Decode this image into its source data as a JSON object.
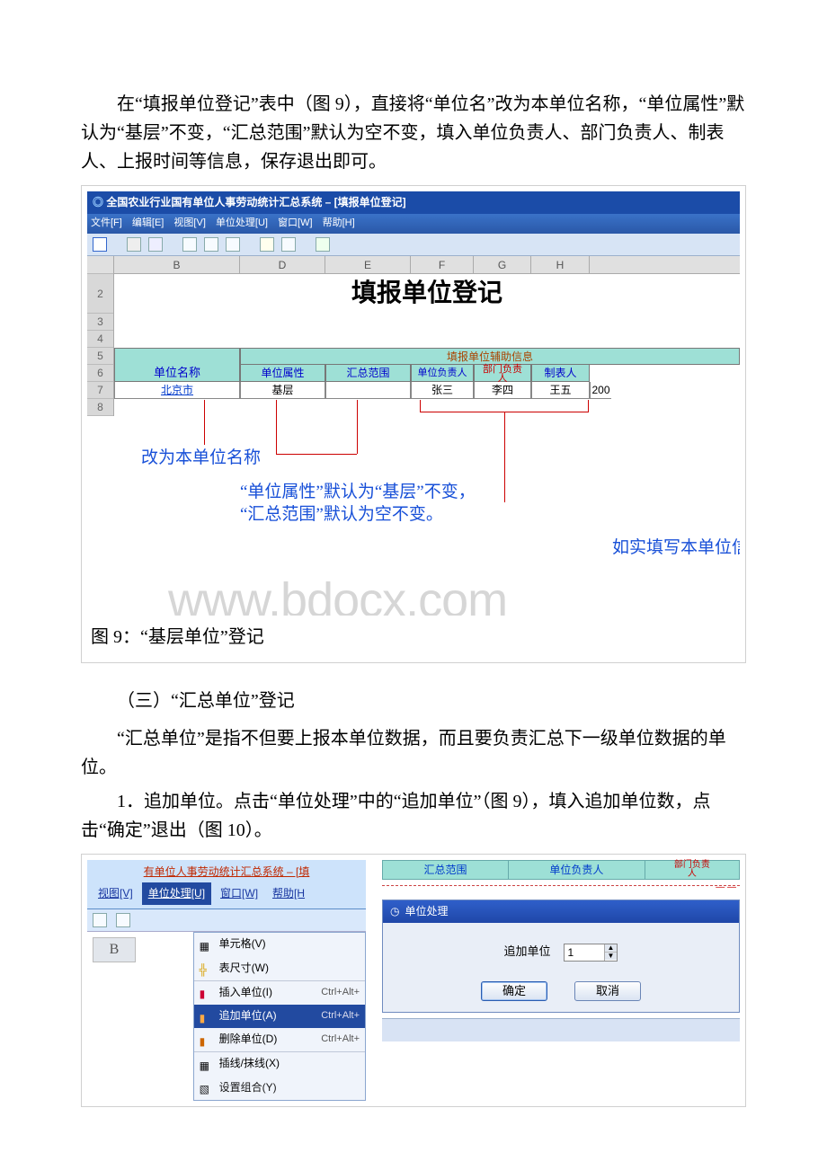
{
  "para1": "在“填报单位登记”表中（图 9），直接将“单位名”改为本单位名称，“单位属性”默认为“基层”不变，“汇总范围”默认为空不变，填入单位负责人、部门负责人、制表人、上报时间等信息，保存退出即可。",
  "figure9": {
    "titlebar": "全国农业行业国有单位人事劳动统计汇总系统 – [填报单位登记]",
    "menus": {
      "file": "文件[F]",
      "edit": "编辑[E]",
      "view": "视图[V]",
      "unit": "单位处理[U]",
      "window": "窗口[W]",
      "help": "帮助[H]"
    },
    "cols": {
      "B": "B",
      "D": "D",
      "E": "E",
      "F": "F",
      "G": "G",
      "H": "H"
    },
    "rows": {
      "r2": "2",
      "r3": "3",
      "r4": "4",
      "r5": "5",
      "r6": "6",
      "r7": "7",
      "r8": "8"
    },
    "bigtitle": "填报单位登记",
    "aux_header": "填报单位辅助信息",
    "headers": {
      "unit_name": "单位名称",
      "attr": "单位属性",
      "range": "汇总范围",
      "leader": "单位负责人",
      "dept": "部门负责\n人",
      "tabulator": "制表人"
    },
    "data": {
      "unit_name": "北京市",
      "attr": "基层",
      "range": "",
      "leader": "张三",
      "dept": "李四",
      "tabulator": "王五",
      "extra": "200"
    },
    "note1": "改为本单位名称",
    "note2a": "“单位属性”默认为“基层”不变，",
    "note2b": "“汇总范围”默认为空不变。",
    "note3": "如实填写本单位信",
    "watermark": "www.bdocx.com",
    "caption": "图 9：“基层单位”登记"
  },
  "section2_title": "（三）“汇总单位”登记",
  "para2": "“汇总单位”是指不但要上报本单位数据，而且要负责汇总下一级单位数据的单位。",
  "para3": "1．追加单位。点击“单位处理”中的“追加单位”（图 9），填入追加单位数，点击“确定”退出（图 10）。",
  "figure10": {
    "left": {
      "top_title": "有单位人事劳动统计汇总系统 – [填",
      "menus": {
        "view": "视图[V]",
        "unit": "单位处理[U]",
        "window": "窗口[W]",
        "help": "帮助[H"
      },
      "col_B": "B",
      "menu_items": {
        "cell": "单元格(V)",
        "size": "表尺寸(W)",
        "insert": "插入单位(I)",
        "append": "追加单位(A)",
        "delete": "删除单位(D)",
        "line": "插线/抹线(X)",
        "group": "设置组合(Y)"
      },
      "shortcuts": {
        "insert": "Ctrl+Alt+",
        "append": "Ctrl+Alt+",
        "delete": "Ctrl+Alt+"
      }
    },
    "right": {
      "strip": {
        "range": "汇总范围",
        "leader": "单位负责人",
        "dept": "部门负责\n人"
      },
      "window_title": "单位处理",
      "spin_label": "追加单位",
      "spin_value": "1",
      "ok": "确定",
      "cancel": "取消"
    }
  }
}
